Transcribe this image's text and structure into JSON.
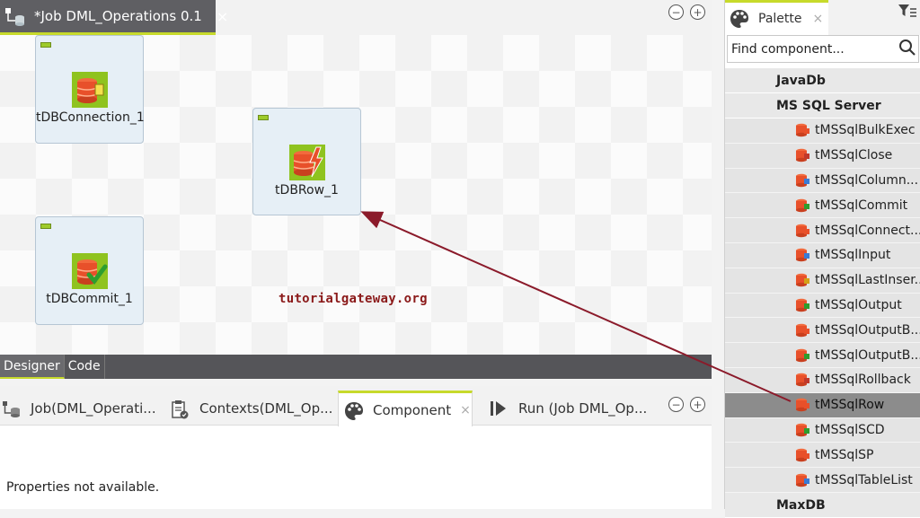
{
  "editor": {
    "tab_title": "*Job DML_Operations 0.1",
    "close_glyph": "×",
    "minimize_glyph": "−",
    "maximize_glyph": "+"
  },
  "canvas": {
    "components": [
      {
        "label": "tDBConnection_1",
        "icon": "db-connection-icon"
      },
      {
        "label": "tDBRow_1",
        "icon": "db-row-icon"
      },
      {
        "label": "tDBCommit_1",
        "icon": "db-commit-icon"
      }
    ],
    "watermark": "tutorialgateway.org"
  },
  "view_tabs": [
    "Designer",
    "Code"
  ],
  "bottom": {
    "tabs": [
      {
        "label": "Job(DML_Operati...",
        "icon": "job-icon"
      },
      {
        "label": "Contexts(DML_Op...",
        "icon": "contexts-icon"
      },
      {
        "label": "Component",
        "icon": "palette-icon"
      },
      {
        "label": "Run (Job DML_Op...",
        "icon": "run-icon"
      }
    ],
    "close_glyph": "×",
    "minimize_glyph": "−",
    "maximize_glyph": "+",
    "properties_text": "Properties not available."
  },
  "palette": {
    "tab_label": "Palette",
    "close_glyph": "×",
    "search_placeholder": "Find component...",
    "categories": {
      "javadb": "JavaDb",
      "mssql": "MS SQL Server",
      "maxdb": "MaxDB"
    },
    "items": [
      "tMSSqlBulkExec",
      "tMSSqlClose",
      "tMSSqlColumn...",
      "tMSSqlCommit",
      "tMSSqlConnect...",
      "tMSSqlInput",
      "tMSSqlLastInser...",
      "tMSSqlOutput",
      "tMSSqlOutputB...",
      "tMSSqlOutputB...",
      "tMSSqlRollback",
      "tMSSqlRow",
      "tMSSqlSCD",
      "tMSSqlSP",
      "tMSSqlTableList"
    ],
    "selected_item": "tMSSqlRow"
  },
  "colors": {
    "accent": "#c7da2b",
    "arrow": "#8b1a2a",
    "db_orange": "#e8502a",
    "db_green": "#8fc31f"
  }
}
